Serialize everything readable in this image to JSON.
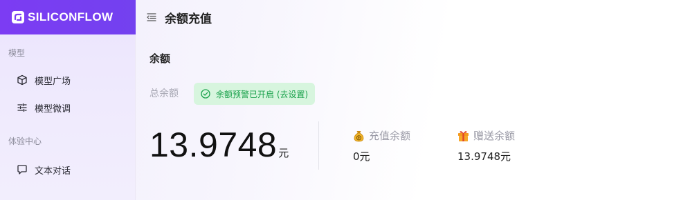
{
  "app": {
    "brand": "SILICONFLOW"
  },
  "header": {
    "title": "余额充值"
  },
  "sidebar": {
    "groups": [
      {
        "label": "模型",
        "items": [
          {
            "label": "模型广场",
            "icon": "cube-icon"
          },
          {
            "label": "模型微调",
            "icon": "sliders-icon"
          }
        ]
      },
      {
        "label": "体验中心",
        "items": [
          {
            "label": "文本对话",
            "icon": "chat-icon"
          }
        ]
      }
    ]
  },
  "balance": {
    "section_title": "余额",
    "total_label": "总余额",
    "alert_text": "余额预警已开启 (去设置)",
    "total_amount": "13.9748",
    "unit": "元",
    "recharge": {
      "label": "充值余额",
      "value": "0元",
      "icon": "money-bag-icon"
    },
    "gift": {
      "label": "赠送余额",
      "value": "13.9748元",
      "icon": "gift-icon"
    }
  },
  "colors": {
    "brand": "#7c3cf3",
    "alert_bg": "#d7f5de",
    "alert_text": "#18a14a"
  }
}
